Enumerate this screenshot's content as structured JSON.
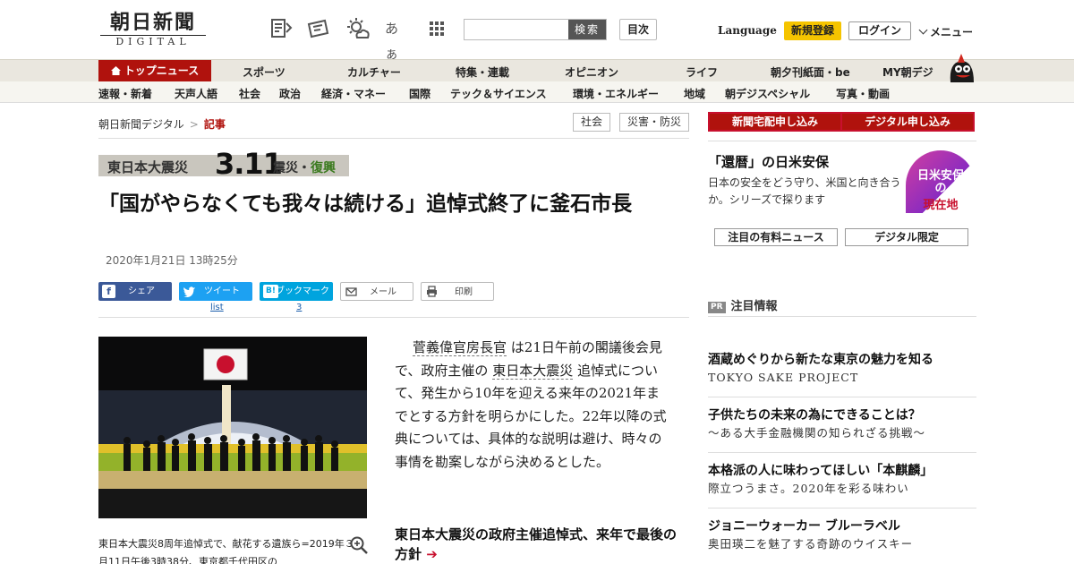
{
  "header": {
    "logo_jp": "朝日新聞",
    "logo_en": "DIGITAL",
    "search_button": "検索",
    "search_placeholder": "",
    "contents_button": "目次",
    "language": "Language",
    "register": "新規登録",
    "login": "ログイン",
    "menu": "メニュー",
    "font_size_glyph": "あぁ"
  },
  "nav_primary": [
    "トップニュース",
    "スポーツ",
    "カルチャー",
    "特集・連載",
    "オピニオン",
    "ライフ",
    "朝夕刊紙面・be",
    "MY朝デジ"
  ],
  "nav_secondary": [
    "速報・新着",
    "天声人語",
    "社会",
    "政治",
    "経済・マネー",
    "国際",
    "テック＆サイエンス",
    "環境・エネルギー",
    "地域",
    "朝デジスペシャル",
    "写真・動画"
  ],
  "breadcrumb": {
    "root": "朝日新聞デジタル",
    "separator": ">",
    "current": "記事"
  },
  "tags": [
    "社会",
    "災害・防災"
  ],
  "banner": {
    "part1": "東日本大震災",
    "part2": "3.11",
    "part3a": "震災・",
    "part3b": "復興"
  },
  "article": {
    "title": "「国がやらなくても我々は続ける」追悼式終了に釜石市長",
    "date": "2020年1月21日 13時25分",
    "body_link1": "菅義偉官房長官",
    "body_1": "は21日午前の閣議後会見で、政府主催の",
    "body_link2": "東日本大震災",
    "body_2": "追悼式について、発生から10年を迎える来年の2021年までとする方針を明らかにした。22年以降の式典については、具体的な説明は避け、時々の事情を勘案しながら決めるとした。",
    "caption": "東日本大震災8周年追悼式で、献花する遺族ら=2019年３月11日午後3時38分、東京都千代田区の",
    "related_title": "東日本大震災の政府主催追悼式、来年で最後の方針"
  },
  "share": {
    "facebook": "シェア",
    "twitter": "ツイート",
    "twitter_count": "list",
    "hatena": "ブックマーク",
    "hatena_icon": "B!",
    "hatena_count": "3",
    "mail": "メール",
    "print": "印刷"
  },
  "sidebar": {
    "btn_home": "新聞宅配申し込み",
    "btn_digital": "デジタル申し込み",
    "feature_title": "「還暦」の日米安保",
    "feature_desc": "日本の安全をどう守り、米国と向き合うか。シリーズで探ります",
    "ad_title": "日米安保",
    "ad_mid": "の",
    "ad_sub": "現在地",
    "sub_btn1": "注目の有料ニュース",
    "sub_btn2": "デジタル限定",
    "pr_badge": "PR",
    "pr_label": "注目情報",
    "pr_items": [
      {
        "headline": "酒蔵めぐりから新たな東京の魅力を知る",
        "sub": "TOKYO SAKE PROJECT"
      },
      {
        "headline": "子供たちの未来の為にできることは？",
        "sub": "～ある大手金融機関の知られざる挑戦～"
      },
      {
        "headline": "本格派の人に味わってほしい「本麒麟」",
        "sub": "際立つうまさ。2020年を彩る味わい"
      },
      {
        "headline": "ジョニーウォーカー ブルーラベル",
        "sub": "奥田瑛二を魅了する奇跡のウイスキー"
      }
    ]
  },
  "colors": {
    "accent": "#b0120d",
    "nav_bg": "#eae7df",
    "register": "#f5c400",
    "facebook": "#3b5998",
    "twitter": "#1da1f2",
    "hatena": "#00a4de"
  }
}
